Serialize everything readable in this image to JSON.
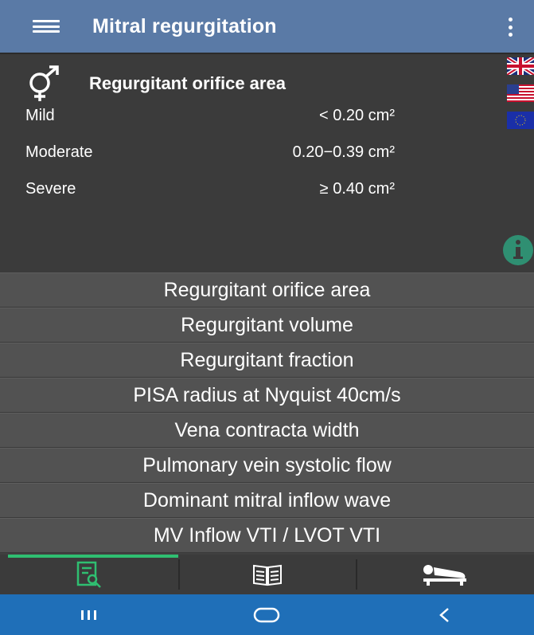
{
  "app_bar": {
    "title": "Mitral regurgitation",
    "menu_icon": "hamburger-menu-icon",
    "overflow_icon": "more-vert-icon",
    "color": "#5a7aa6"
  },
  "result": {
    "gender_icon": "male-female-icon",
    "title": "Regurgitant orifice area",
    "grades": [
      {
        "label": "Mild",
        "value": "< 0.20 cm²"
      },
      {
        "label": "Moderate",
        "value": "0.20−0.39 cm²"
      },
      {
        "label": "Severe",
        "value": "≥ 0.40 cm²"
      }
    ],
    "flags": [
      "uk-flag-icon",
      "us-flag-icon",
      "eu-flag-icon"
    ],
    "info_icon": "info-icon"
  },
  "parameters": [
    "Regurgitant orifice area",
    "Regurgitant volume",
    "Regurgitant fraction",
    "PISA radius at Nyquist 40cm/s",
    "Vena contracta width",
    "Pulmonary vein systolic flow",
    "Dominant mitral inflow wave",
    "MV Inflow VTI / LVOT VTI"
  ],
  "tabs": [
    {
      "icon": "document-search-icon",
      "active": true
    },
    {
      "icon": "book-icon",
      "active": false
    },
    {
      "icon": "patient-bed-icon",
      "active": false
    }
  ],
  "system_nav": [
    "recents-icon",
    "home-icon",
    "back-icon"
  ],
  "colors": {
    "accent": "#2fbf71",
    "nav_bar": "#1f6fb8",
    "background": "#404040"
  }
}
